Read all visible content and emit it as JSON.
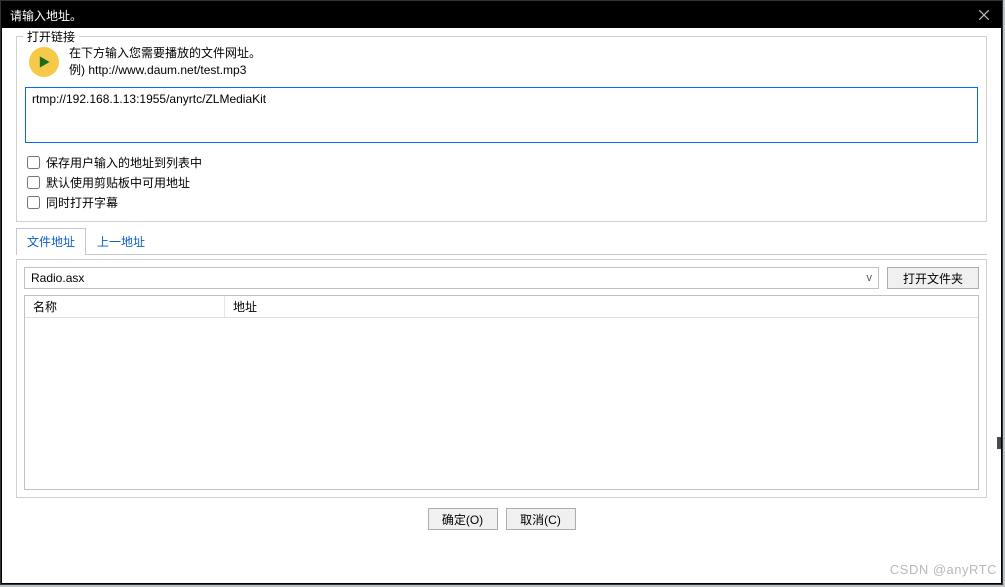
{
  "title": "请输入地址。",
  "group1": {
    "legend": "打开链接",
    "instruction": "在下方输入您需要播放的文件网址。",
    "example": "例) http://www.daum.net/test.mp3",
    "url_value": "rtmp://192.168.1.13:1955/anyrtc/ZLMediaKit",
    "options": {
      "save_list": "保存用户输入的地址到列表中",
      "clipboard": "默认使用剪贴板中可用地址",
      "subtitle": "同时打开字幕"
    }
  },
  "tabs": {
    "file_addr": "文件地址",
    "prev_addr": "上一地址"
  },
  "file": {
    "selected": "Radio.asx",
    "open_folder": "打开文件夹"
  },
  "columns": {
    "name": "名称",
    "addr": "地址"
  },
  "buttons": {
    "ok": "确定(O)",
    "cancel": "取消(C)"
  },
  "watermark": "CSDN @anyRTC"
}
